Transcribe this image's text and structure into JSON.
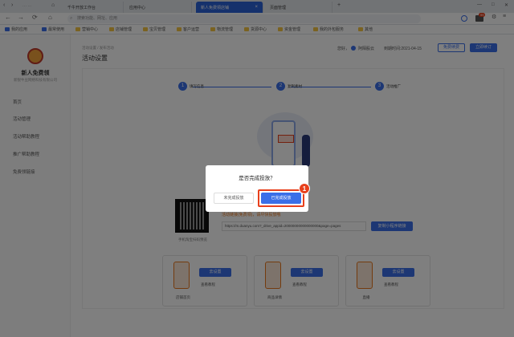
{
  "browser": {
    "tabs": [
      {
        "label": "千牛开放工作台"
      },
      {
        "label": "应用中心"
      },
      {
        "label": "新人免费领店铺"
      },
      {
        "label": "页面管理"
      }
    ],
    "address_placeholder": "搜索功能、网址、应用",
    "notif_count": "99"
  },
  "bookmarks": [
    "我的应用",
    "最常使用",
    "营销中心",
    "店铺管理",
    "宝贝管理",
    "客户运营",
    "物流管理",
    "货源中心",
    "资金管理",
    "我的外包服务",
    "其他"
  ],
  "sidebar": {
    "brand": "新人免费领",
    "company": "新锐牛豆网络科技有限公司",
    "items": [
      "首页",
      "活动管理",
      "活动帮助教程",
      "推广帮助教程",
      "免费领链接"
    ]
  },
  "header": {
    "breadcrumb": "活动设置 / 发布活动",
    "title": "活动设置",
    "user": "您好，",
    "shop": "阿陌股云",
    "expiry": "到期时间:2021-04-15",
    "renew_btn": "免费续费",
    "order_btn": "立即续订"
  },
  "steps": [
    {
      "num": "1",
      "label": "填写信息"
    },
    {
      "num": "2",
      "label": "复制素材"
    },
    {
      "num": "3",
      "label": "活动推广"
    }
  ],
  "share": {
    "hint": "活动链接(免费领)，请尽快投放哦",
    "link": "https://m.duanyu.com?_drive_appid=20000000000000000&page=pages",
    "copy_btn": "复制小程序链接",
    "qr_caption": "手机淘宝扫码预览"
  },
  "placements": [
    {
      "btn": "去设置",
      "sub": "查看教程",
      "caption": "店铺首页"
    },
    {
      "btn": "去设置",
      "sub": "查看教程",
      "caption": "商品详情"
    },
    {
      "btn": "去设置",
      "sub": "查看教程",
      "caption": "直播"
    }
  ],
  "modal": {
    "title": "是否完成投放？",
    "cancel": "未完成投放",
    "confirm": "已完成投放"
  },
  "annotation": {
    "number": "1"
  },
  "colors": {
    "accent": "#3a6fe8",
    "highlight": "#e8401c"
  }
}
